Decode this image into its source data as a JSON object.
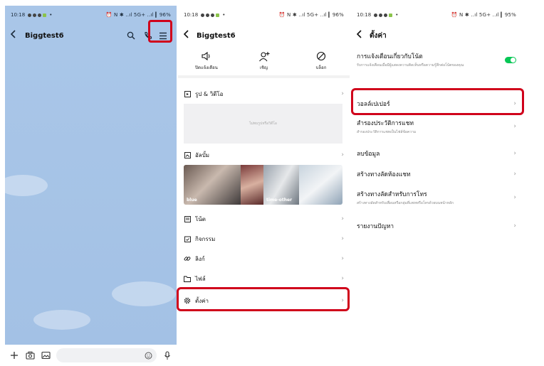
{
  "panel1": {
    "status": {
      "time": "10:18",
      "indicators": "⏰ N ✱ ..ıl 5G+ ..ıl ▎96%"
    },
    "header": {
      "title": "Biggtest6"
    },
    "input": {}
  },
  "panel2": {
    "status": {
      "time": "10:18",
      "indicators": "⏰ N ✱ ..ıl 5G+ ..ıl ▎96%"
    },
    "header": {
      "title": "Biggtest6"
    },
    "quick_actions": [
      {
        "label": "ปิดแจ้งเตือน",
        "icon": "speaker-mute-icon"
      },
      {
        "label": "เชิญ",
        "icon": "add-user-icon"
      },
      {
        "label": "บล็อก",
        "icon": "block-icon"
      }
    ],
    "photos": {
      "label": "รูป & วิดีโอ",
      "empty_text": "ไม่พบรูปหรือวิดีโอ"
    },
    "albums": {
      "label": "อัลบั้ม",
      "items": [
        {
          "name": "blue"
        },
        {
          "name": ""
        },
        {
          "name": "time-other"
        },
        {
          "name": ""
        }
      ]
    },
    "items": [
      {
        "label": "โน้ต",
        "icon": "note-icon"
      },
      {
        "label": "กิจกรรม",
        "icon": "calendar-icon"
      },
      {
        "label": "ลิงก์",
        "icon": "link-icon"
      },
      {
        "label": "ไฟล์",
        "icon": "folder-icon"
      },
      {
        "label": "ตั้งค่า",
        "icon": "gear-icon"
      }
    ]
  },
  "panel3": {
    "status": {
      "time": "10:18",
      "indicators": "⏰ N ✱ ..ıl 5G+ ..ıl ▎95%"
    },
    "header": {
      "title": "ตั้งค่า"
    },
    "notify": {
      "label": "การแจ้งเตือนเกี่ยวกับโน้ต",
      "sub": "รับการแจ้งเตือนเมื่อมีผู้แสดงความคิดเห็นหรือความรู้สึกต่อโน้ตของคุณ",
      "enabled": true
    },
    "rows": [
      {
        "label": "วอลล์เปเปอร์",
        "sub": ""
      },
      {
        "label": "สำรองประวัติการแชท",
        "sub": "สำรองประวัติการแชทเป็นไฟล์ข้อความ"
      },
      {
        "label": "ลบข้อมูล",
        "sub": ""
      },
      {
        "label": "สร้างทางลัดห้องแชท",
        "sub": ""
      },
      {
        "label": "สร้างทางลัดสำหรับการโทร",
        "sub": "สร้างทางลัดสำหรับเพื่อนหรือกลุ่มที่แชทหรือโทรด้วยบนหน้าหลัก"
      },
      {
        "label": "รายงานปัญหา",
        "sub": ""
      }
    ]
  },
  "colors": {
    "chat_bg": "#a9c6e8",
    "highlight": "#d0021b",
    "toggle_on": "#06c755"
  }
}
